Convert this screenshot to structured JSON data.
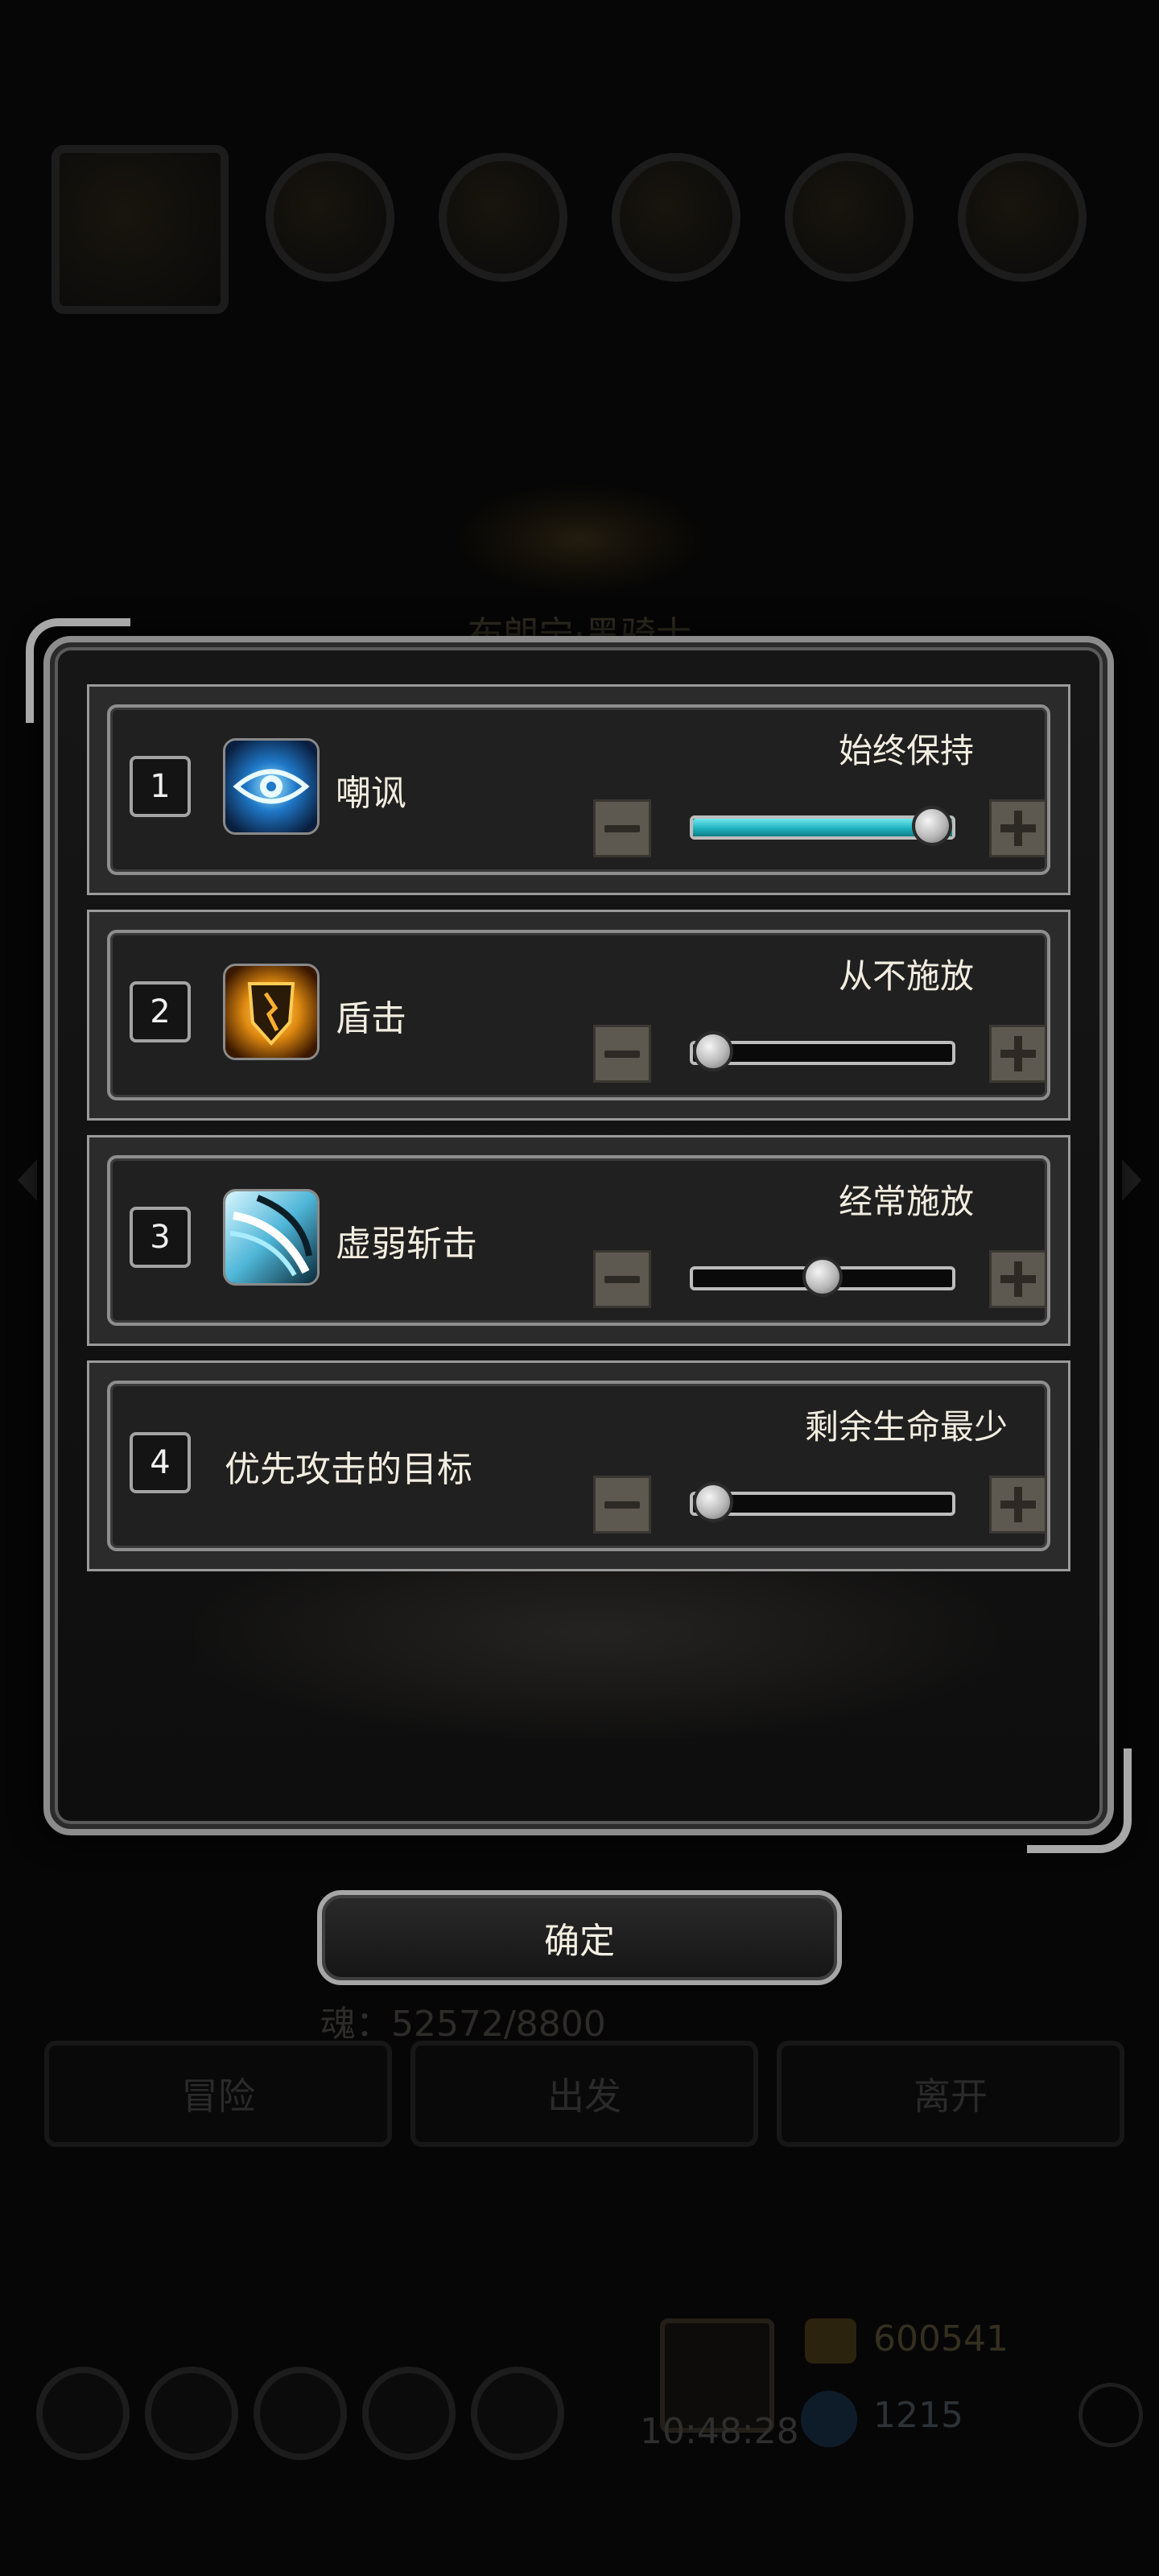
{
  "background": {
    "hero_title": "布朗宁·黑骑士",
    "soul_text": "魂：52572/8800",
    "tabs": [
      "冒险",
      "出发",
      "离开"
    ],
    "time": "10:48:28",
    "gold": "600541",
    "gems": "1215"
  },
  "rows": [
    {
      "index": "1",
      "name": "嘲讽",
      "icon": "eye-icon",
      "setting": "始终保持",
      "level": 1.0
    },
    {
      "index": "2",
      "name": "盾击",
      "icon": "shield-icon",
      "setting": "从不施放",
      "level": 0.0
    },
    {
      "index": "3",
      "name": "虚弱斩击",
      "icon": "slash-icon",
      "setting": "经常施放",
      "level": 0.5
    },
    {
      "index": "4",
      "name": "优先攻击的目标",
      "icon": null,
      "setting": "剩余生命最少",
      "level": 0.0
    }
  ],
  "confirm_label": "确定",
  "colors": {
    "slider_fill": "#1fb3bf",
    "step_button": "#5d5850"
  }
}
